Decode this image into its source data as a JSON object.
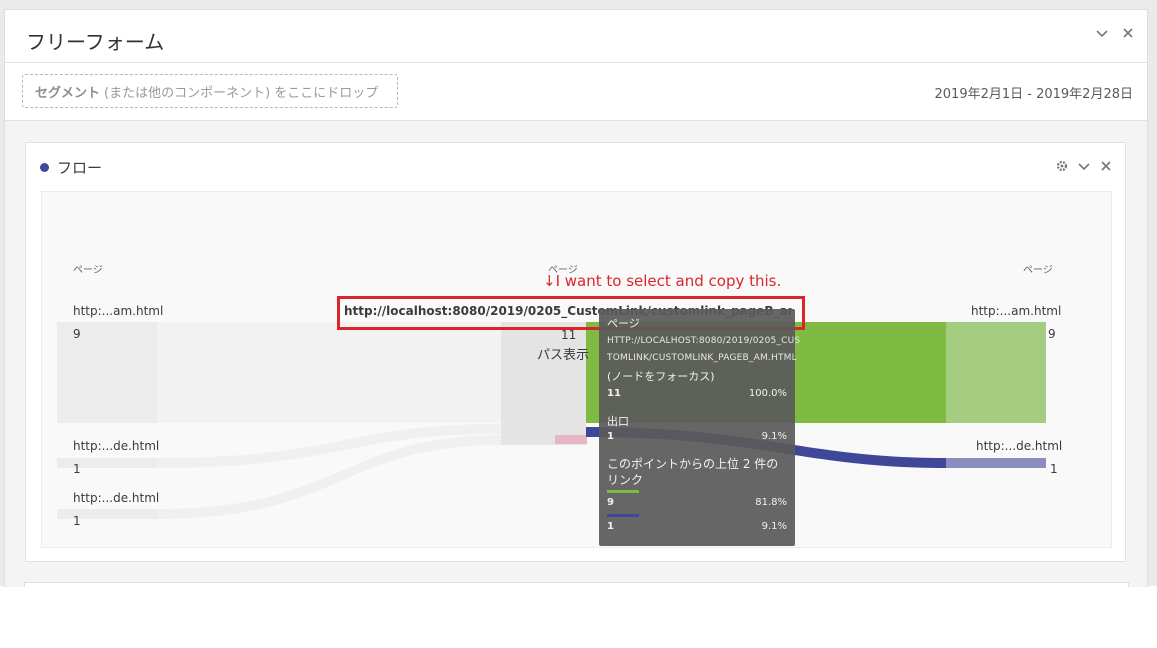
{
  "panel": {
    "title": "フリーフォーム"
  },
  "segment": {
    "bold": "セグメント",
    "rest": "(または他のコンポーネント) をここにドロップ"
  },
  "date_range": "2019年2月1日 - 2019年2月28日",
  "viz": {
    "title": "フロー"
  },
  "flow": {
    "col_left_header": "ページ",
    "col_mid_header": "ページ",
    "col_right_header": "ページ",
    "left_nodes": [
      {
        "label": "http:...am.html",
        "value": "9"
      },
      {
        "label": "http:...de.html",
        "value": "1"
      },
      {
        "label": "http:...de.html",
        "value": "1"
      }
    ],
    "mid_node": {
      "label": "http://localhost:8080/2019/0205_CustomLink/customlink_pageB_am.html",
      "value": "11",
      "path_label": "パス表示"
    },
    "right_nodes": [
      {
        "label": "http:...am.html",
        "value": "9"
      },
      {
        "label": "http:...de.html",
        "value": "1"
      }
    ],
    "colors": {
      "green": "#7fba42",
      "green_light": "#a5cd81",
      "purple": "#3f4798",
      "purple_light": "#8a8fc0",
      "grey": "#ececec"
    }
  },
  "annotation": "↓I want to select and copy this.",
  "tooltip": {
    "type": "ページ",
    "url": "HTTP://LOCALHOST:8080/2019/0205_CUSTOMLINK/CUSTOMLINK_PAGEB_AM.HTML",
    "url_line1": "HTTP://LOCALHOST:8080/2019/0205_CUS",
    "url_line2": "TOMLINK/CUSTOMLINK_PAGEB_AM.HTML",
    "focus_label": "(ノードをフォーカス)",
    "node_value": "11",
    "node_pct": "100.0%",
    "exit_label": "出口",
    "exit_value": "1",
    "exit_pct": "9.1%",
    "links_title": "このポイントからの上位 2 件のリンク",
    "links": [
      {
        "value": "9",
        "pct": "81.8%",
        "color": "#7fba42"
      },
      {
        "value": "1",
        "pct": "9.1%",
        "color": "#3f4798"
      }
    ]
  }
}
